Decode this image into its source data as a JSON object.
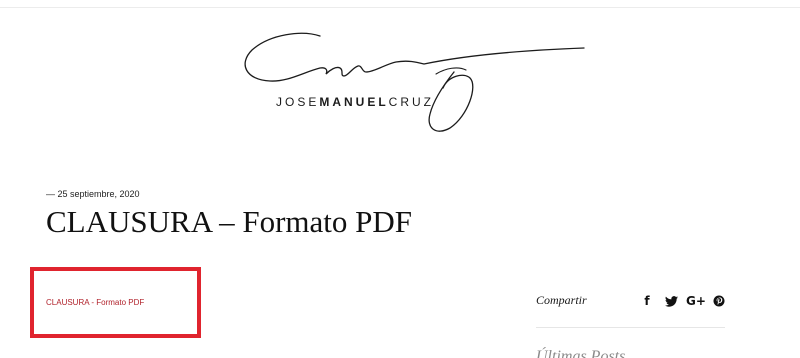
{
  "logo": {
    "text_light_1": "JOSE",
    "text_bold": "MANUEL",
    "text_light_2": "CRUZ"
  },
  "post": {
    "date": "— 25 septiembre, 2020",
    "title": "CLAUSURA – Formato PDF",
    "attachment_link": "CLAUSURA - Formato PDF"
  },
  "sidebar": {
    "share_label": "Compartir",
    "share_icons": [
      "facebook-icon",
      "twitter-icon",
      "google-plus-icon",
      "pinterest-icon"
    ],
    "facebook_glyph": "f",
    "google_plus_glyph": "G+",
    "recent_posts_heading": "Últimas Posts"
  },
  "colors": {
    "highlight_border": "#e0242e",
    "link": "#b1232c",
    "text": "#111111"
  }
}
